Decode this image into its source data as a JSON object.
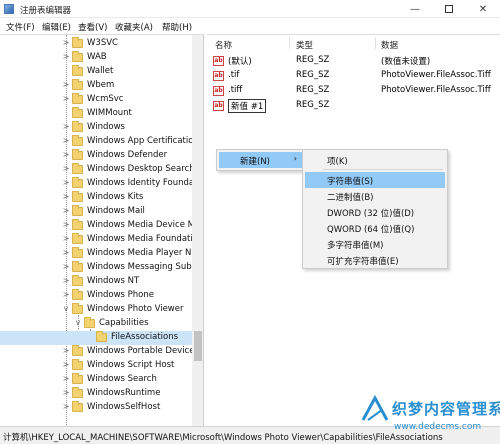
{
  "window": {
    "title": "注册表编辑器",
    "minimize": "—",
    "close": "✕"
  },
  "menubar": [
    "文件(F)",
    "编辑(E)",
    "查看(V)",
    "收藏夹(A)",
    "帮助(H)"
  ],
  "tree": [
    {
      "label": "W3SVC",
      "expander": ">"
    },
    {
      "label": "WAB",
      "expander": ">"
    },
    {
      "label": "Wallet",
      "expander": ""
    },
    {
      "label": "Wbem",
      "expander": ">"
    },
    {
      "label": "WcmSvc",
      "expander": ">"
    },
    {
      "label": "WIMMount",
      "expander": ""
    },
    {
      "label": "Windows",
      "expander": ">"
    },
    {
      "label": "Windows App Certification",
      "expander": ">"
    },
    {
      "label": "Windows Defender",
      "expander": ">"
    },
    {
      "label": "Windows Desktop Search",
      "expander": ">"
    },
    {
      "label": "Windows Identity Foundati",
      "expander": ">"
    },
    {
      "label": "Windows Kits",
      "expander": ">"
    },
    {
      "label": "Windows Mail",
      "expander": ">"
    },
    {
      "label": "Windows Media Device M",
      "expander": ">"
    },
    {
      "label": "Windows Media Foundatic",
      "expander": ">"
    },
    {
      "label": "Windows Media Player NS",
      "expander": ">"
    },
    {
      "label": "Windows Messaging Subs",
      "expander": ">"
    },
    {
      "label": "Windows NT",
      "expander": ">"
    },
    {
      "label": "Windows Phone",
      "expander": ">"
    },
    {
      "label": "Windows Photo Viewer",
      "expander": "v"
    },
    {
      "label": "Capabilities",
      "expander": "v"
    },
    {
      "label": "FileAssociations",
      "expander": ""
    },
    {
      "label": "Windows Portable Devices",
      "expander": ">"
    },
    {
      "label": "Windows Script Host",
      "expander": ">"
    },
    {
      "label": "Windows Search",
      "expander": ">"
    },
    {
      "label": "WindowsRuntime",
      "expander": ">"
    },
    {
      "label": "WindowsSelfHost",
      "expander": ">"
    }
  ],
  "columns": {
    "name": "名称",
    "type": "类型",
    "data": "数据"
  },
  "values": [
    {
      "icon": "ab",
      "name": "(默认)",
      "type": "REG_SZ",
      "data": "(数值未设置)"
    },
    {
      "icon": "ab",
      "name": ".tif",
      "type": "REG_SZ",
      "data": "PhotoViewer.FileAssoc.Tiff"
    },
    {
      "icon": "ab",
      "name": ".tiff",
      "type": "REG_SZ",
      "data": "PhotoViewer.FileAssoc.Tiff"
    },
    {
      "icon": "ab",
      "name": "新值 #1",
      "type": "REG_SZ",
      "data": ""
    }
  ],
  "context_menu": {
    "new_label": "新建(N)",
    "arrow": "›"
  },
  "submenu": [
    "项(K)",
    "字符串值(S)",
    "二进制值(B)",
    "DWORD (32 位)值(D)",
    "QWORD (64 位)值(Q)",
    "多字符串值(M)",
    "可扩充字符串值(E)"
  ],
  "status": "计算机\\HKEY_LOCAL_MACHINE\\SOFTWARE\\Microsoft\\Windows Photo Viewer\\Capabilities\\FileAssociations",
  "watermark": {
    "line1": "织梦内容管理系统",
    "line2": "www.dedecms.com"
  },
  "colors": {
    "selection": "#cce4f7",
    "menu_highlight": "#91c9f7",
    "folder": "#f3d272",
    "watermark": "#2a8fd0"
  }
}
